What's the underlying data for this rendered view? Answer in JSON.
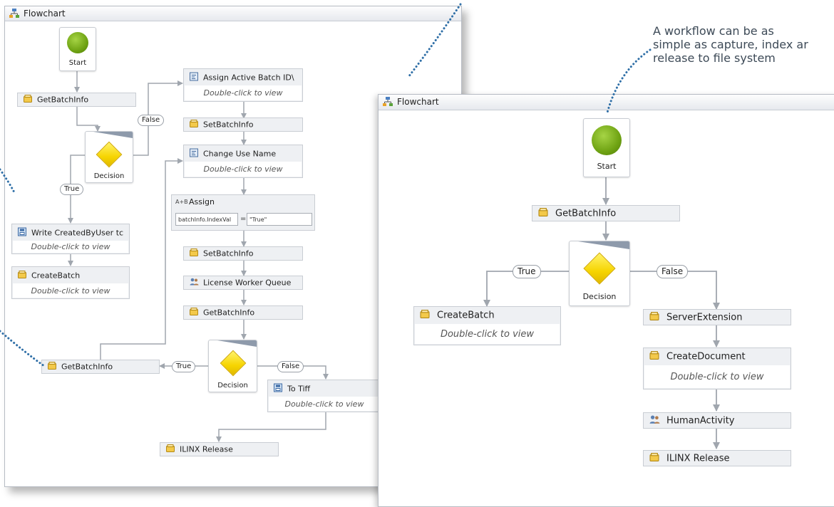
{
  "left_flowchart": {
    "title": "Flowchart",
    "start_label": "Start",
    "getbatchinfo_1": "GetBatchInfo",
    "decision_1": "Decision",
    "label_false_1": "False",
    "label_true_1": "True",
    "assign_active_batch": "Assign Active Batch ID\\",
    "set_batch_info_1": "SetBatchInfo",
    "change_use_name": "Change Use Name",
    "assign_title": "Assign",
    "assign_left": "batchInfo.IndexVal",
    "assign_eq": "=",
    "assign_right": "\"True\"",
    "set_batch_info_2": "SetBatchInfo",
    "license_worker_queue": "License Worker Queue",
    "getbatchinfo_2": "GetBatchInfo",
    "write_created_by_user": "Write CreatedByUser tc",
    "create_batch": "CreateBatch",
    "getbatchinfo_3": "GetBatchInfo",
    "label_true_2": "True",
    "decision_2": "Decision",
    "label_false_2": "False",
    "to_tiff": "To Tiff",
    "ilinx_release": "ILINX Release",
    "double_click": "Double-click to view"
  },
  "annotation": {
    "line1": "A workflow can be as",
    "line2": "simple as capture, index ar",
    "line3": "release to file system"
  },
  "right_flowchart": {
    "title": "Flowchart",
    "start_label": "Start",
    "getbatchinfo": "GetBatchInfo",
    "decision": "Decision",
    "label_true": "True",
    "label_false": "False",
    "create_batch": "CreateBatch",
    "server_extension": "ServerExtension",
    "create_document": "CreateDocument",
    "human_activity": "HumanActivity",
    "ilinx_release": "ILINX Release",
    "double_click": "Double-click to view"
  },
  "colors": {
    "connector": "#a0a6ae",
    "annotation_dots": "#2f6fa7",
    "start_green": "#6fa313",
    "decision_yellow": "#f6d400"
  }
}
